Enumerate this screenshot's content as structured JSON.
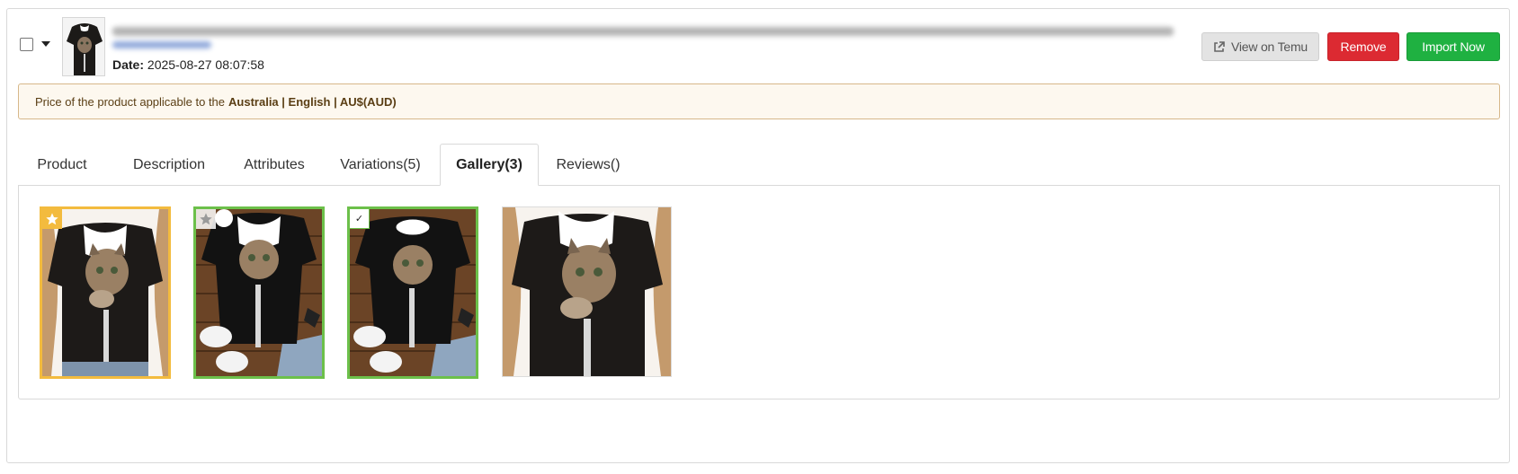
{
  "header": {
    "date_label": "Date:",
    "date_value": "2025-08-27 08:07:58",
    "buttons": {
      "view": "View on Temu",
      "remove": "Remove",
      "import": "Import Now"
    }
  },
  "notice": {
    "prefix": "Price of the product applicable to the",
    "region": "Australia | English | AU$(AUD)"
  },
  "tabs": [
    {
      "label": "Product"
    },
    {
      "label": "Description"
    },
    {
      "label": "Attributes"
    },
    {
      "label": "Variations(5)"
    },
    {
      "label": "Gallery(3)",
      "active": true
    },
    {
      "label": "Reviews()"
    }
  ],
  "gallery": [
    {
      "state": "main",
      "border": "#f3bb3e",
      "icon": "star-icon"
    },
    {
      "state": "selected",
      "border": "#6cc04a",
      "icon": "star-icon"
    },
    {
      "state": "selected-checked",
      "border": "#6cc04a",
      "icon": "check-icon"
    },
    {
      "state": "unselected",
      "border": "#dcdcdc"
    }
  ],
  "colors": {
    "remove": "#dc2a32",
    "import": "#1fb141",
    "main_image": "#f3bb3e",
    "selected_image": "#6cc04a",
    "notice_bg": "#fdf8ef"
  }
}
